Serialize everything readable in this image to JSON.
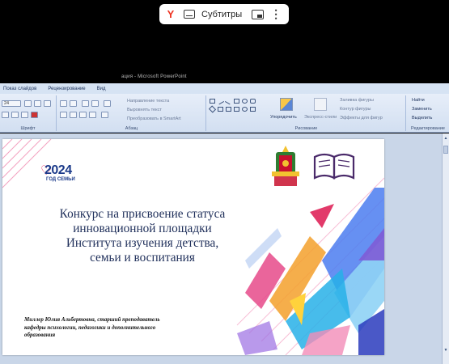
{
  "player": {
    "subtitles_label": "Субтитры",
    "yandex_glyph": "Y",
    "more_glyph": "⋮"
  },
  "window": {
    "title": "ация - Microsoft PowerPoint"
  },
  "ribbon": {
    "tabs": [
      "Показ слайдов",
      "Рецензирование",
      "Вид"
    ],
    "font_size": "24",
    "groups": {
      "font": "Шрифт",
      "paragraph": "Абзац",
      "drawing": "Рисование",
      "editing": "Редактирование"
    },
    "paragraph_items": [
      "Направление текста",
      "Выровнять текст",
      "Преобразовать в SmartArt"
    ],
    "drawing_items": {
      "arrange": "Упорядочить",
      "quick_styles": "Экспресс-стили",
      "fill": "Заливка фигуры",
      "outline": "Контур фигуры",
      "effects": "Эффекты для фигур"
    },
    "editing_items": [
      "Найти",
      "Заменить",
      "Выделить"
    ]
  },
  "slide": {
    "logo_number": "2024",
    "logo_subtitle": "ГОД СЕМЬИ",
    "title_lines": [
      "Конкурс на присвоение статуса",
      "инновационной площадки",
      "Института изучения детства,",
      "семьи и воспитания"
    ],
    "author_lines": [
      "Миллер Юлия Альбертовна, старший преподаватель",
      "кафедры психологии, педагогики  и дополнительного",
      "образования"
    ]
  },
  "colors": {
    "ribbon_bg": "#dbe6f4",
    "title_color": "#1f2f5a",
    "accent_pink": "#e2336a",
    "accent_blue": "#1b3a8a"
  }
}
